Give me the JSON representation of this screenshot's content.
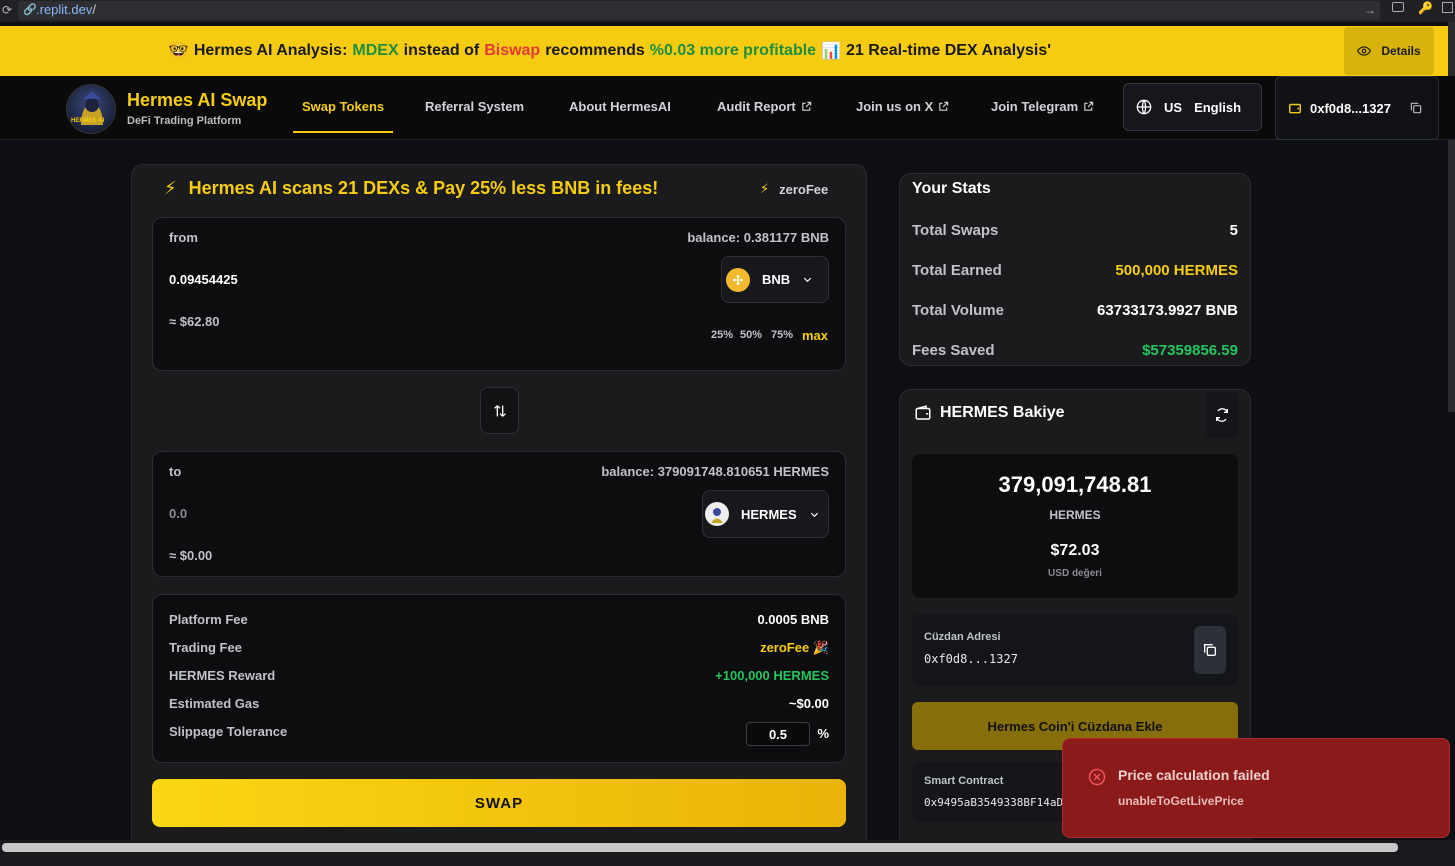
{
  "browser": {
    "url_prefix": "",
    "url_domain": ".replit.dev",
    "url_suffix": "/"
  },
  "banner": {
    "emoji": "🤓",
    "part1": "Hermes AI Analysis:",
    "dex_good": "MDEX",
    "part2": "instead of",
    "dex_bad": "Biswap",
    "part3": "recommends",
    "profit": "%0.03 more profitable",
    "chart_emoji": "📊",
    "part4": "21 Real-time DEX Analysis'",
    "details_label": "Details"
  },
  "header": {
    "logo_text": "HERMES AI",
    "title": "Hermes AI Swap",
    "subtitle": "DeFi Trading Platform",
    "nav": [
      {
        "label": "Swap Tokens",
        "external": false
      },
      {
        "label": "Referral System",
        "external": false
      },
      {
        "label": "About HermesAI",
        "external": false
      },
      {
        "label": "Audit Report",
        "external": true
      },
      {
        "label": "Join us on X",
        "external": true
      },
      {
        "label": "Join Telegram",
        "external": true
      }
    ],
    "lang_code": "US",
    "lang_name": "English",
    "wallet": "0xf0d8...1327"
  },
  "swap": {
    "headline": "Hermes AI scans 21 DEXs & Pay 25% less BNB in fees!",
    "zero_fee_tag": "zeroFee",
    "from": {
      "label": "from",
      "balance": "balance: 0.381177 BNB",
      "amount": "0.09454425",
      "usd": "≈ $62.80",
      "token": "BNB",
      "pcts": [
        "25%",
        "50%",
        "75%",
        "max"
      ]
    },
    "to": {
      "label": "to",
      "balance": "balance: 379091748.810651 HERMES",
      "amount": "0.0",
      "usd": "≈ $0.00",
      "token": "HERMES"
    },
    "fees": {
      "platform_label": "Platform Fee",
      "platform_value": "0.0005 BNB",
      "trading_label": "Trading Fee",
      "trading_value": "zeroFee 🎉",
      "reward_label": "HERMES Reward",
      "reward_value": "+100,000 HERMES",
      "gas_label": "Estimated Gas",
      "gas_value": "~$0.00",
      "slippage_label": "Slippage Tolerance",
      "slippage_value": "0.5",
      "slippage_unit": "%"
    },
    "swap_label": "SWAP"
  },
  "stats": {
    "title": "Your Stats",
    "total_swaps_label": "Total Swaps",
    "total_swaps": "5",
    "total_earned_label": "Total Earned",
    "total_earned": "500,000 HERMES",
    "total_volume_label": "Total Volume",
    "total_volume": "63733173.9927 BNB",
    "fees_saved_label": "Fees Saved",
    "fees_saved": "$57359856.59"
  },
  "balance": {
    "title": "HERMES Bakiye",
    "amount": "379,091,748.81",
    "token": "HERMES",
    "usd": "$72.03",
    "usd_label": "USD değeri",
    "address_label": "Cüzdan Adresi",
    "address": "0xf0d8...1327",
    "add_wallet_label": "Hermes Coin'i Cüzdana Ekle",
    "contract_label": "Smart Contract",
    "contract": "0x9495aB3549338BF14aD"
  },
  "toast": {
    "title": "Price calculation failed",
    "message": "unableToGetLivePrice"
  },
  "colors": {
    "accent": "#f6cc12",
    "success": "#22c55e",
    "error": "#8b1a1a"
  }
}
